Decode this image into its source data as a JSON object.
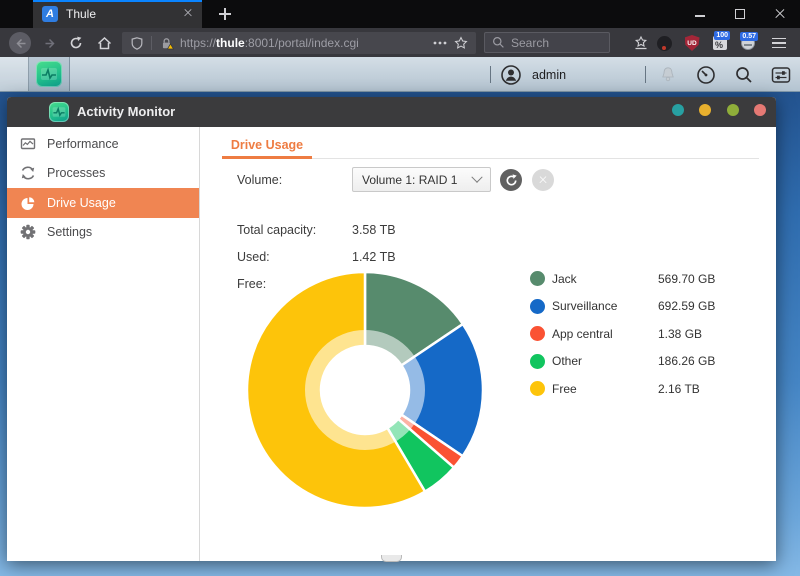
{
  "browser": {
    "tab_title": "Thule",
    "favicon_letter": "A",
    "url": {
      "prefix": "https://",
      "host": "thule",
      "rest": ":8001/portal/index.cgi"
    },
    "search_placeholder": "Search",
    "ext": {
      "shield_label": "UD",
      "percent_badge": "100",
      "percent_glyph": "%",
      "timer_badge": "0.57"
    }
  },
  "taskbar": {
    "username": "admin"
  },
  "win": {
    "title": "Activity Monitor",
    "accent_orange": "#f08552",
    "control_dots": [
      {
        "name": "dot-teal",
        "color": "#27a0a2"
      },
      {
        "name": "dot-amber",
        "color": "#e8b02e"
      },
      {
        "name": "dot-olive",
        "color": "#8fae3a"
      },
      {
        "name": "dot-red",
        "color": "#e57974"
      }
    ],
    "sidebar": [
      {
        "label": "Performance",
        "selected": false
      },
      {
        "label": "Processes",
        "selected": false
      },
      {
        "label": "Drive Usage",
        "selected": true
      },
      {
        "label": "Settings",
        "selected": false
      }
    ],
    "tab_label": "Drive Usage",
    "fields": {
      "volume_label": "Volume:",
      "volume_value": "Volume 1: RAID 1",
      "total_label": "Total capacity:",
      "total_value": "3.58 TB",
      "used_label": "Used:",
      "used_value": "1.42 TB",
      "free_label": "Free:",
      "free_value": "2.16 TB"
    }
  },
  "chart_data": {
    "type": "pie",
    "donut": true,
    "title": "Drive Usage - Volume 1: RAID 1",
    "total_capacity": "3.58 TB",
    "start_angle_deg": 0,
    "direction": "clockwise",
    "legend_position": "right",
    "segments": [
      {
        "label": "Jack",
        "display": "569.70 GB",
        "value_gb": 569.7,
        "color": "#578b6d"
      },
      {
        "label": "Surveillance",
        "display": "692.59 GB",
        "value_gb": 692.59,
        "color": "#1569c7"
      },
      {
        "label": "App central",
        "display": "1.38 GB",
        "value_gb": 1.38,
        "color": "#fa5233"
      },
      {
        "label": "Other",
        "display": "186.26 GB",
        "value_gb": 186.26,
        "color": "#11c55f"
      },
      {
        "label": "Free",
        "display": "2.16 TB",
        "value_gb": 2211.84,
        "color": "#fdc40a"
      }
    ]
  }
}
